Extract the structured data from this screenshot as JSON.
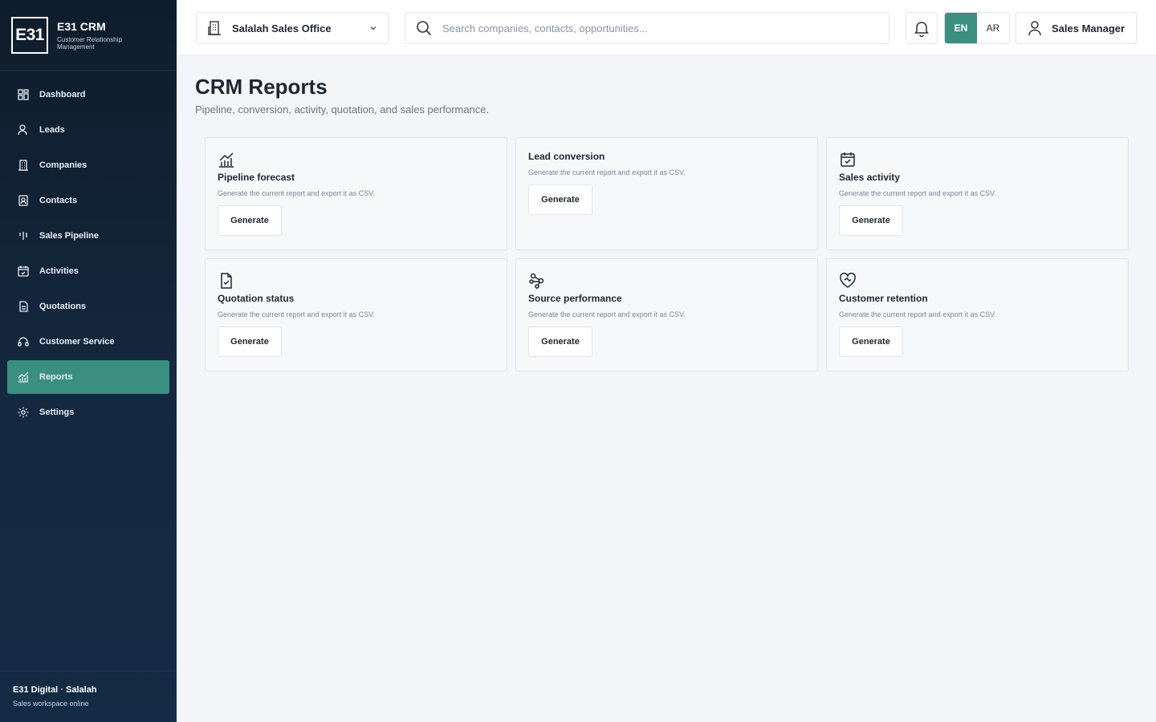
{
  "brand": {
    "logo": "E31",
    "name": "E31 CRM",
    "subtitle": "Customer Relationship Management"
  },
  "sidebar": {
    "items": [
      {
        "label": "Dashboard",
        "icon": "grid-icon"
      },
      {
        "label": "Leads",
        "icon": "user-icon"
      },
      {
        "label": "Companies",
        "icon": "building-icon"
      },
      {
        "label": "Contacts",
        "icon": "contact-card-icon"
      },
      {
        "label": "Sales Pipeline",
        "icon": "pipeline-icon"
      },
      {
        "label": "Activities",
        "icon": "calendar-icon"
      },
      {
        "label": "Quotations",
        "icon": "document-icon"
      },
      {
        "label": "Customer Service",
        "icon": "headset-icon"
      },
      {
        "label": "Reports",
        "icon": "chart-icon",
        "active": true
      },
      {
        "label": "Settings",
        "icon": "gear-icon"
      }
    ],
    "footer": {
      "title": "E31 Digital · Salalah",
      "subtitle": "Sales workspace online"
    }
  },
  "header": {
    "office": "Salalah Sales Office",
    "search_placeholder": "Search companies, contacts, opportunities...",
    "lang_en": "EN",
    "lang_ar": "AR",
    "user": "Sales Manager"
  },
  "page": {
    "title": "CRM Reports",
    "subtitle": "Pipeline, conversion, activity, quotation, and sales performance."
  },
  "reports": [
    {
      "title": "Pipeline forecast",
      "desc": "Generate the current report and export it as CSV.",
      "button": "Generate",
      "icon": "chart-icon"
    },
    {
      "title": "Lead conversion",
      "desc": "Generate the current report and export it as CSV.",
      "button": "Generate",
      "icon": ""
    },
    {
      "title": "Sales activity",
      "desc": "Generate the current report and export it as CSV.",
      "button": "Generate",
      "icon": "calendar-check-icon"
    },
    {
      "title": "Quotation status",
      "desc": "Generate the current report and export it as CSV.",
      "button": "Generate",
      "icon": "document-check-icon"
    },
    {
      "title": "Source performance",
      "desc": "Generate the current report and export it as CSV.",
      "button": "Generate",
      "icon": "workflow-icon"
    },
    {
      "title": "Customer retention",
      "desc": "Generate the current report and export it as CSV.",
      "button": "Generate",
      "icon": "heart-handshake-icon"
    }
  ],
  "colors": {
    "accent": "#3a8f80",
    "sidebar": "#14283f",
    "background": "#f3f5f8"
  }
}
